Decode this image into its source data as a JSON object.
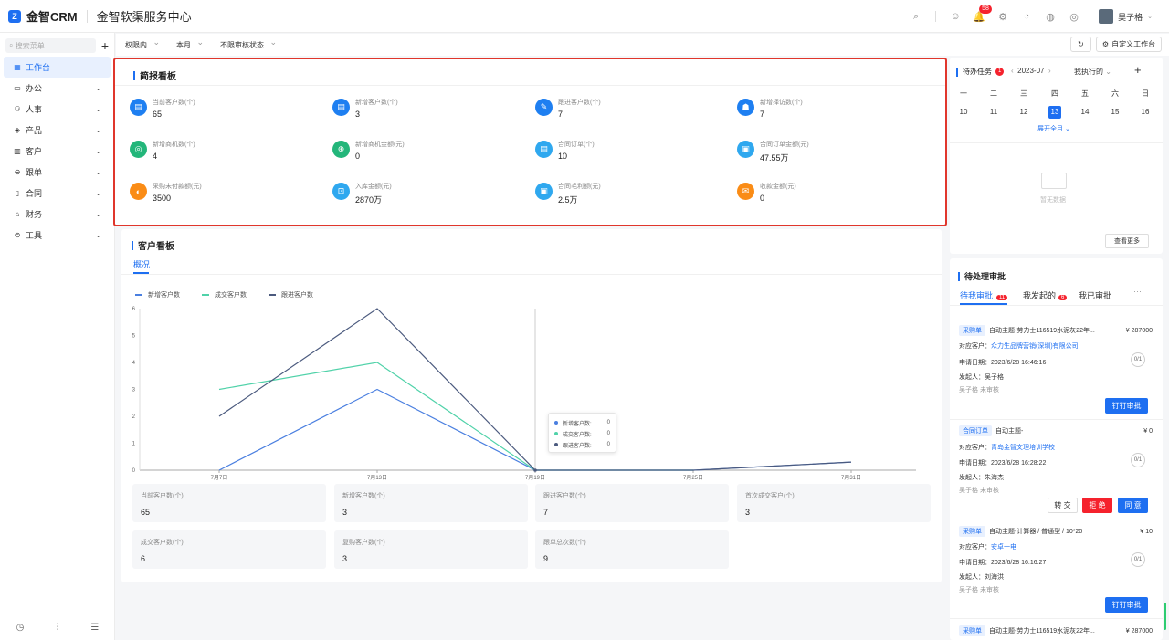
{
  "app": {
    "brand": "金智CRM",
    "title": "金智软渠服务中心",
    "user": "吴子格",
    "badges": {
      "bell": "58"
    }
  },
  "sidebar": {
    "search_placeholder": "搜索菜单",
    "items": [
      {
        "label": "工作台",
        "icon": "dashboard-icon"
      },
      {
        "label": "办公",
        "icon": "office-icon"
      },
      {
        "label": "人事",
        "icon": "people-icon"
      },
      {
        "label": "产品",
        "icon": "product-icon"
      },
      {
        "label": "客户",
        "icon": "customer-icon"
      },
      {
        "label": "跟单",
        "icon": "followup-icon"
      },
      {
        "label": "合同",
        "icon": "contract-icon"
      },
      {
        "label": "财务",
        "icon": "finance-icon"
      },
      {
        "label": "工具",
        "icon": "tools-icon"
      }
    ]
  },
  "filters": {
    "scope": "权限内",
    "period": "本月",
    "status": "不限审核状态",
    "customize": "自定义工作台"
  },
  "brief": {
    "title": "简报看板",
    "stats": [
      {
        "label": "当前客户数(个)",
        "value": "65",
        "color": "#1e7ff1"
      },
      {
        "label": "新增客户数(个)",
        "value": "3",
        "color": "#1e7ff1"
      },
      {
        "label": "跟进客户数(个)",
        "value": "7",
        "color": "#1e7ff1"
      },
      {
        "label": "新增择访数(个)",
        "value": "7",
        "color": "#1e7ff1"
      },
      {
        "label": "新增商机数(个)",
        "value": "4",
        "color": "#23b67a"
      },
      {
        "label": "新增商机金额(元)",
        "value": "0",
        "color": "#23b67a"
      },
      {
        "label": "合同订单(个)",
        "value": "10",
        "color": "#2fa8ef"
      },
      {
        "label": "合同订单金额(元)",
        "value": "47.55万",
        "color": "#2fa8ef"
      },
      {
        "label": "采购未付款额(元)",
        "value": "3500",
        "color": "#fa8c16"
      },
      {
        "label": "入库金额(元)",
        "value": "2870万",
        "color": "#2fa8ef"
      },
      {
        "label": "合同毛利额(元)",
        "value": "2.5万",
        "color": "#2fa8ef"
      },
      {
        "label": "收款金额(元)",
        "value": "0",
        "color": "#fa8c16"
      }
    ]
  },
  "customer": {
    "title": "客户看板",
    "tab": "概况",
    "tooltip": {
      "rows": [
        {
          "name": "新增客户数:",
          "value": "0"
        },
        {
          "name": "成交客户数:",
          "value": "0"
        },
        {
          "name": "跟进客户数:",
          "value": "0"
        }
      ]
    },
    "tiles": [
      {
        "label": "当前客户数(个)",
        "value": "65"
      },
      {
        "label": "新增客户数(个)",
        "value": "3"
      },
      {
        "label": "跟进客户数(个)",
        "value": "7"
      },
      {
        "label": "首次成交客户(个)",
        "value": "3"
      },
      {
        "label": "成交客户数(个)",
        "value": "6"
      },
      {
        "label": "复购客户数(个)",
        "value": "3"
      },
      {
        "label": "跟单总次数(个)",
        "value": "9"
      }
    ]
  },
  "chart_data": {
    "type": "line",
    "x": [
      "7月7日",
      "7月13日",
      "7月19日",
      "7月25日",
      "7月31日"
    ],
    "ylim": [
      0,
      6
    ],
    "yticks": [
      "0",
      "1",
      "2",
      "3",
      "4",
      "5",
      "6"
    ],
    "grid": false,
    "legend_position": "top-left",
    "series": [
      {
        "name": "新增客户数",
        "color": "#4a7fe0",
        "points": [
          [
            0,
            0
          ],
          [
            1,
            3
          ],
          [
            2,
            0
          ],
          [
            3,
            0
          ],
          [
            4,
            0.3
          ]
        ]
      },
      {
        "name": "成交客户数",
        "color": "#50d2a9",
        "points": [
          [
            0,
            3
          ],
          [
            1,
            4
          ],
          [
            2,
            0
          ],
          [
            3,
            0
          ]
        ]
      },
      {
        "name": "跟进客户数",
        "color": "#4b5a7e",
        "points": [
          [
            0,
            2
          ],
          [
            1,
            6
          ],
          [
            2,
            0
          ],
          [
            3,
            0
          ],
          [
            4,
            0.3
          ]
        ]
      }
    ]
  },
  "todo": {
    "title": "待办任务",
    "count": "1",
    "month": "2023-07",
    "mine": "我执行的",
    "weekdays": [
      "一",
      "二",
      "三",
      "四",
      "五",
      "六",
      "日"
    ],
    "days": [
      "10",
      "11",
      "12",
      "13",
      "14",
      "15",
      "16"
    ],
    "today": "13",
    "expand": "展开全月",
    "empty": "暂无数据",
    "more": "查看更多"
  },
  "approvals": {
    "title": "待处理审批",
    "tabs": [
      {
        "label": "待我审批",
        "badge": "11"
      },
      {
        "label": "我发起的",
        "badge": "6"
      },
      {
        "label": "我已审批",
        "badge": ""
      }
    ],
    "more": "···",
    "items": [
      {
        "tag": "采购单",
        "subject": "自动主题-劳力士116519水泥灰22年...",
        "amount": "¥ 287000",
        "customer_label": "对应客户：",
        "customer": "众力生品牌营销(深圳)有限公司",
        "date": "申请日期：2023/6/28 16:46:16",
        "initiator": "发起人：吴子格",
        "status": "吴子格 未审核",
        "ratio": "0/1",
        "action": "钉钉审批"
      },
      {
        "tag": "合同订单",
        "subject": "自动主题-",
        "amount": "¥ 0",
        "customer_label": "对应客户：",
        "customer": "青岛金智文理培训学校",
        "date": "申请日期：2023/6/28 16:28:22",
        "initiator": "发起人：朱海杰",
        "status": "吴子格 未审核",
        "ratio": "0/1",
        "transfer": "转 交",
        "reject": "拒 绝",
        "agree": "同 意"
      },
      {
        "tag": "采购单",
        "subject": "自动主题-计算器 / 普通型 / 10*20",
        "amount": "¥ 10",
        "customer_label": "对应客户：",
        "customer": "安卓一电",
        "date": "申请日期：2023/6/28 16:16:27",
        "initiator": "发起人：刘海洪",
        "status": "吴子格 未审核",
        "ratio": "0/1",
        "action": "钉钉审批"
      },
      {
        "tag": "采购单",
        "subject": "自动主题-劳力士116519水泥灰22年...",
        "amount": "¥ 287000"
      }
    ]
  }
}
